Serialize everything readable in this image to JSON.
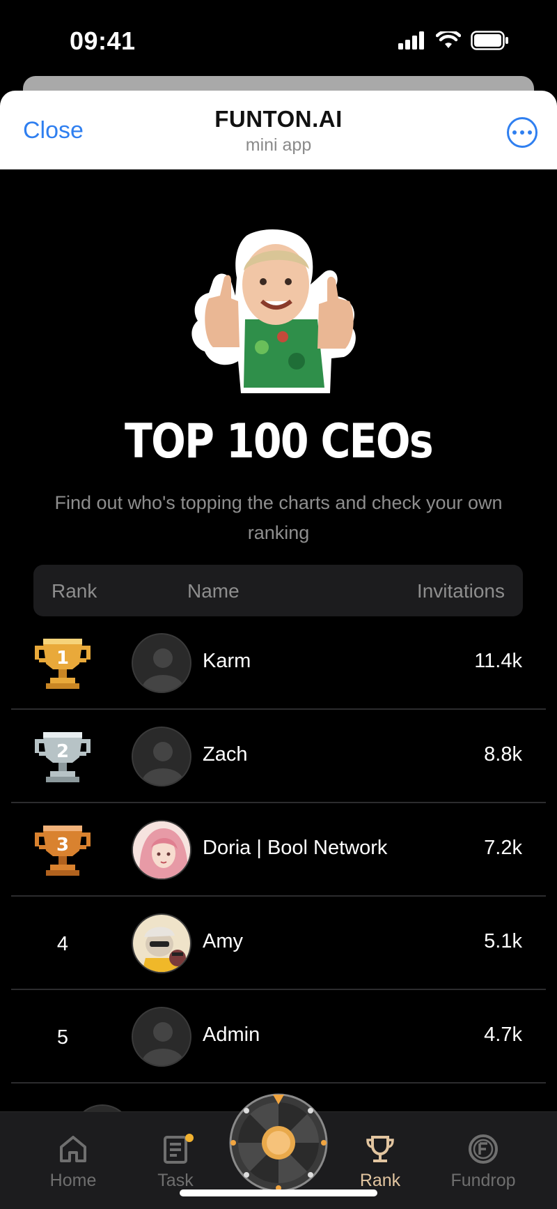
{
  "status_bar": {
    "time": "09:41"
  },
  "header": {
    "close_label": "Close",
    "title": "FUNTON.AI",
    "subtitle": "mini app"
  },
  "hero": {
    "title": "TOP 100 CEOs",
    "description": "Find out who's topping the charts and check your own ranking"
  },
  "table": {
    "columns": {
      "rank": "Rank",
      "name": "Name",
      "invitations": "Invitations"
    },
    "rows": [
      {
        "rank": "1",
        "rank_icon": "gold-trophy-icon",
        "name": "Karm",
        "invitations": "11.4k",
        "avatar": "default-avatar"
      },
      {
        "rank": "2",
        "rank_icon": "silver-trophy-icon",
        "name": "Zach",
        "invitations": "8.8k",
        "avatar": "default-avatar"
      },
      {
        "rank": "3",
        "rank_icon": "bronze-trophy-icon",
        "name": "Doria | Bool Network",
        "invitations": "7.2k",
        "avatar": "pink-hair-avatar"
      },
      {
        "rank": "4",
        "name": "Amy",
        "invitations": "5.1k",
        "avatar": "cartoon-avatar"
      },
      {
        "rank": "5",
        "name": "Admin",
        "invitations": "4.7k",
        "avatar": "default-avatar"
      }
    ]
  },
  "nav": {
    "items": [
      {
        "label": "Home",
        "icon": "home-icon"
      },
      {
        "label": "Task",
        "icon": "task-icon"
      },
      {
        "label": "Rank",
        "icon": "trophy-icon",
        "active": true
      },
      {
        "label": "Fundrop",
        "icon": "fundrop-coin-icon"
      }
    ],
    "center": "spin-wheel-icon"
  },
  "colors": {
    "accent_blue": "#2f7ff0",
    "nav_active": "#e2c5a0",
    "gold": "#f2b230"
  }
}
